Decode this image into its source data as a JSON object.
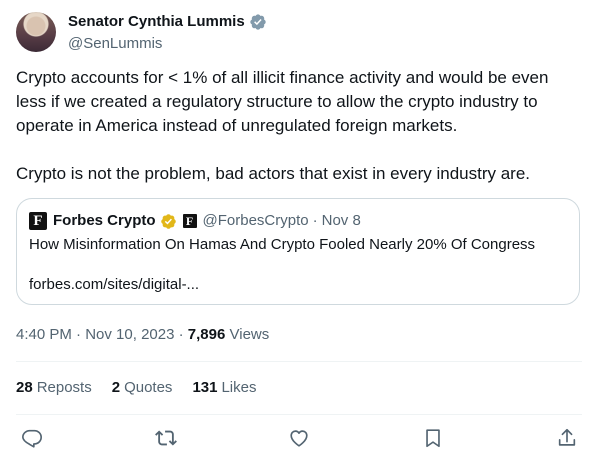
{
  "author": {
    "name": "Senator Cynthia Lummis",
    "handle": "@SenLummis"
  },
  "tweet": {
    "paragraph1": "Crypto accounts for < 1% of all illicit finance activity and would be even less if we created a regulatory structure to allow the crypto industry to operate in America instead of unregulated foreign markets.",
    "paragraph2": "Crypto is not the problem, bad actors that exist in every industry are."
  },
  "quote": {
    "logo_letter": "F",
    "name": "Forbes Crypto",
    "handle": "@ForbesCrypto",
    "separator": "·",
    "date": "Nov 8",
    "title": "How Misinformation On Hamas And Crypto Fooled Nearly 20% Of Congress",
    "link": "forbes.com/sites/digital-..."
  },
  "meta": {
    "time": "4:40 PM",
    "date": "Nov 10, 2023",
    "separator": "·",
    "views_count": "7,896",
    "views_label": "Views"
  },
  "stats": {
    "reposts_count": "28",
    "reposts_label": "Reposts",
    "quotes_count": "2",
    "quotes_label": "Quotes",
    "likes_count": "131",
    "likes_label": "Likes"
  },
  "colors": {
    "text": "#0f1419",
    "secondary": "#536471",
    "border": "#cfd9de",
    "verified_gray": "#829aab",
    "verified_gold": "#e2b719"
  },
  "icons": {
    "reply": "reply-icon",
    "repost": "repost-icon",
    "like": "heart-icon",
    "bookmark": "bookmark-icon",
    "share": "share-icon"
  }
}
